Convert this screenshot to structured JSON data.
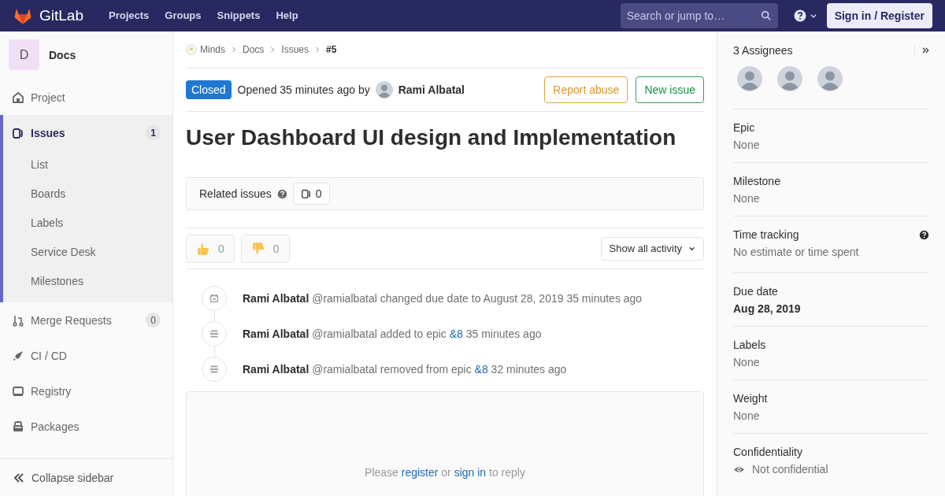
{
  "header": {
    "logo": "GitLab",
    "nav": [
      "Projects",
      "Groups",
      "Snippets",
      "Help"
    ],
    "search": {
      "placeholder": "Search or jump to…"
    },
    "sign_in": "Sign in / Register"
  },
  "sidebar": {
    "project": {
      "letter": "D",
      "name": "Docs"
    },
    "items": [
      {
        "kind": "home",
        "label": "Project",
        "selected": false
      },
      {
        "kind": "issues",
        "label": "Issues",
        "count": "1",
        "selected": true,
        "children": [
          {
            "label": "List"
          },
          {
            "label": "Boards"
          },
          {
            "label": "Labels"
          },
          {
            "label": "Service Desk"
          },
          {
            "label": "Milestones"
          }
        ]
      },
      {
        "kind": "merge",
        "label": "Merge Requests",
        "count": "0",
        "selected": false
      },
      {
        "kind": "rocket",
        "label": "CI / CD",
        "selected": false
      },
      {
        "kind": "registry",
        "label": "Registry",
        "selected": false
      },
      {
        "kind": "package",
        "label": "Packages",
        "selected": false
      }
    ],
    "collapse": "Collapse sidebar"
  },
  "breadcrumbs": [
    "Minds",
    "Docs",
    "Issues",
    "#5"
  ],
  "issue": {
    "status": "Closed",
    "opened": "Opened 35 minutes ago by",
    "author": "Rami Albatal",
    "actions": [
      {
        "kind": "warning",
        "label": "Report abuse"
      },
      {
        "kind": "success",
        "label": "New issue"
      }
    ],
    "title": "User Dashboard UI design and Implementation"
  },
  "related": {
    "label": "Related issues",
    "count": "0"
  },
  "awards": [
    {
      "kind": "thumbsup",
      "count": "0"
    },
    {
      "kind": "thumbsdown",
      "count": "0"
    }
  ],
  "activity_filter": "Show all activity",
  "activity": [
    {
      "kind": "calendar",
      "author": "Rami Albatal",
      "text": "@ramialbatal changed due date to August 28, 2019 35 minutes ago"
    },
    {
      "kind": "epic",
      "author": "Rami Albatal",
      "text": "@ramialbatal added to epic",
      "link": "&8",
      "after": "35 minutes ago"
    },
    {
      "kind": "epic",
      "author": "Rami Albatal",
      "text": "@ramialbatal removed from epic",
      "link": "&8",
      "after": "32 minutes ago"
    }
  ],
  "reply": {
    "before": "Please",
    "link1": "register",
    "middle": "or",
    "link2": "sign in",
    "after": "to reply"
  },
  "right": {
    "assignees_title": "3 Assignees",
    "assignees": [
      {
        "kind": "avatar"
      },
      {
        "kind": "avatar"
      },
      {
        "kind": "avatar"
      }
    ],
    "sections": [
      {
        "kind": "plain",
        "label": "Epic",
        "value": "None"
      },
      {
        "kind": "plain",
        "label": "Milestone",
        "value": "None"
      },
      {
        "kind": "help",
        "label": "Time tracking",
        "value": "No estimate or time spent"
      },
      {
        "kind": "bold",
        "label": "Due date",
        "value": "Aug 28, 2019"
      },
      {
        "kind": "plain",
        "label": "Labels",
        "value": "None"
      },
      {
        "kind": "plain",
        "label": "Weight",
        "value": "None"
      },
      {
        "kind": "eye",
        "label": "Confidentiality",
        "value": "Not confidential"
      }
    ]
  }
}
